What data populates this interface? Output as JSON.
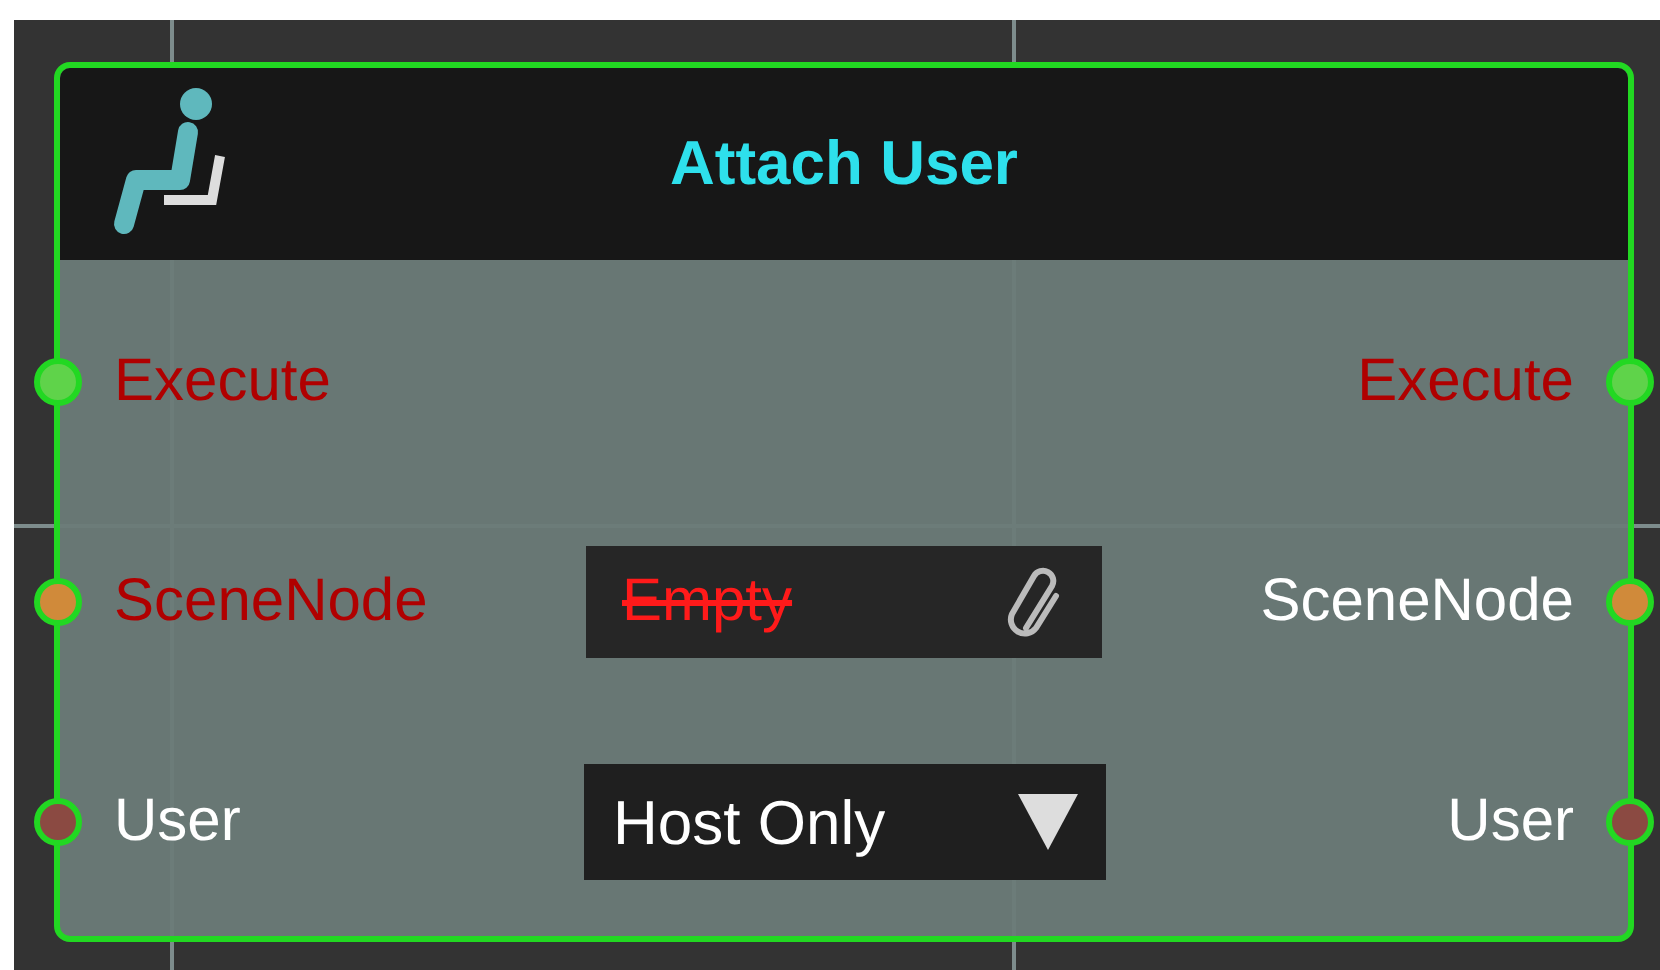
{
  "node": {
    "title": "Attach User",
    "rows": [
      {
        "left": {
          "label": "Execute",
          "highlighted": true,
          "color": "#5fd34a"
        },
        "right": {
          "label": "Execute",
          "highlighted": true,
          "color": "#5fd34a"
        }
      },
      {
        "left": {
          "label": "SceneNode",
          "highlighted": true,
          "color": "#d08a3a"
        },
        "widget": {
          "kind": "object",
          "value": "Empty",
          "invalid": true
        },
        "right": {
          "label": "SceneNode",
          "highlighted": false,
          "color": "#d08a3a"
        }
      },
      {
        "left": {
          "label": "User",
          "highlighted": false,
          "color": "#8b4a42"
        },
        "widget": {
          "kind": "dropdown",
          "value": "Host Only"
        },
        "right": {
          "label": "User",
          "highlighted": false,
          "color": "#8b4a42"
        }
      }
    ]
  }
}
